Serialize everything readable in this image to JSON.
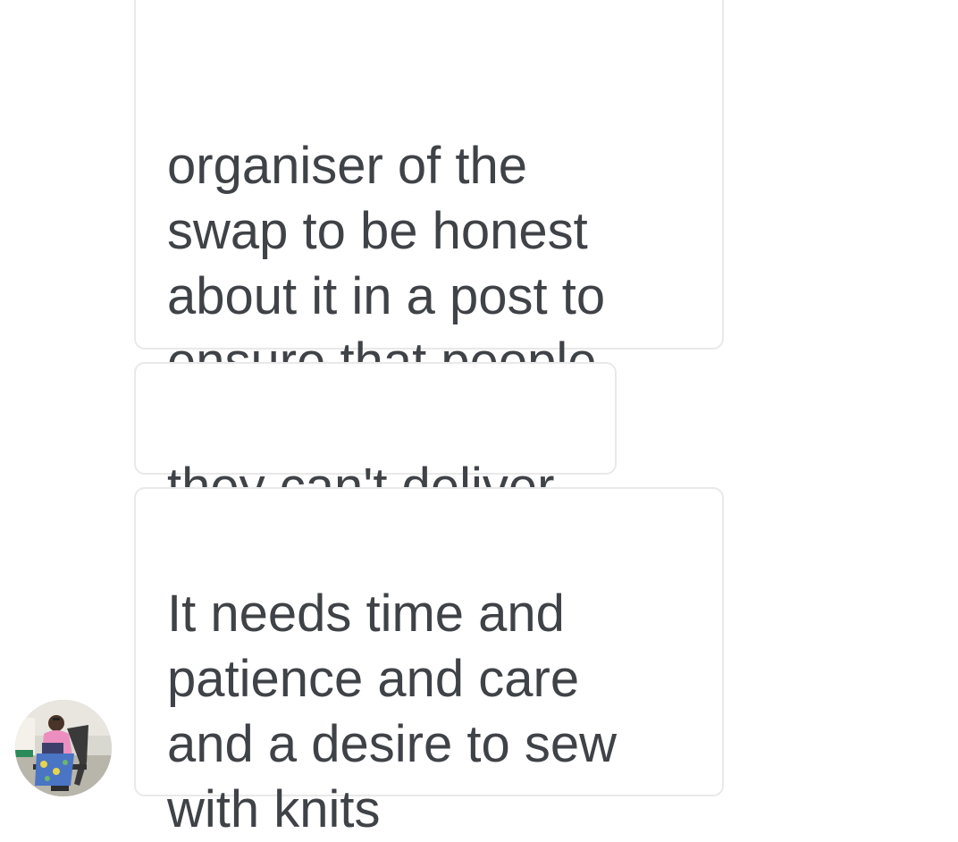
{
  "conversation": {
    "messages": [
      {
        "partial_top_line": "...",
        "text": "organiser of the\nswap to be honest\nabout it in a post to\nensure that people\ndon't sign up if"
      },
      {
        "text": "they can't deliver."
      },
      {
        "text": "It needs time and\npatience and care\nand a desire to sew\nwith knits"
      }
    ]
  },
  "sender": {
    "avatar": "person-sewing-photo",
    "colors": {
      "shirt": "#ec8fc0",
      "skirt": "#4a74c4",
      "chair": "#3a3a3a",
      "background": "#d9d8d0"
    }
  },
  "colors": {
    "bubble_border": "#e9e9e9",
    "text": "#3f4246",
    "background": "#ffffff"
  }
}
